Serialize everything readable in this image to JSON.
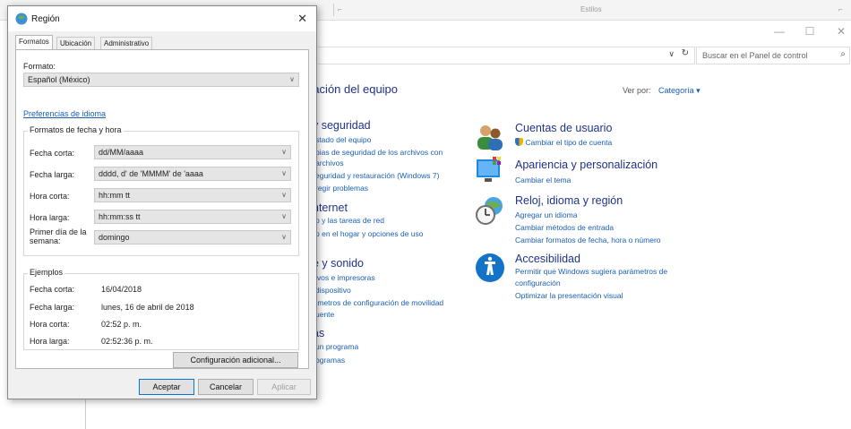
{
  "background": {
    "ribbon": {
      "left_group": "",
      "styles_group": "Estilos"
    },
    "search_placeholder": "Buscar en el Panel de control",
    "heading": "ración del equipo",
    "view_by_label": "Ver por:",
    "view_by_value": "Categoría",
    "left_categories": [
      {
        "title": "y seguridad",
        "links": [
          "stado del equipo",
          "pias de seguridad de los archivos con",
          "archivos",
          "eguridad y restauración (Windows 7)",
          "regir problemas"
        ]
      },
      {
        "title": "nternet",
        "links": [
          "o y las tareas de red",
          "p en el hogar y opciones de uso"
        ]
      },
      {
        "title": "e y sonido",
        "links": [
          "ivos e impresoras",
          "dispositivo",
          "ímetros de configuración de movilidad",
          "uente"
        ]
      },
      {
        "title": "as",
        "links": [
          "un programa",
          "ogramas"
        ]
      }
    ],
    "right_categories": [
      {
        "title": "Cuentas de usuario",
        "icon": "users-icon",
        "links": [
          "Cambiar el tipo de cuenta"
        ]
      },
      {
        "title": "Apariencia y personalización",
        "icon": "appearance-icon",
        "links": [
          "Cambiar el tema"
        ]
      },
      {
        "title": "Reloj, idioma y región",
        "icon": "clock-globe-icon",
        "links": [
          "Agregar un idioma",
          "Cambiar métodos de entrada",
          "Cambiar formatos de fecha, hora o número"
        ]
      },
      {
        "title": "Accesibilidad",
        "icon": "accessibility-icon",
        "links": [
          "Permitir que Windows sugiera parámetros de",
          "configuración",
          "Optimizar la presentación visual"
        ]
      }
    ]
  },
  "dialog": {
    "title": "Región",
    "tabs": [
      "Formatos",
      "Ubicación",
      "Administrativo"
    ],
    "format_label": "Formato:",
    "format_value": "Español (México)",
    "language_prefs_link": "Preferencias de idioma",
    "date_time_group": "Formatos de fecha y hora",
    "fields": [
      {
        "label": "Fecha corta:",
        "value": "dd/MM/aaaa"
      },
      {
        "label": "Fecha larga:",
        "value": "dddd, d' de 'MMMM' de 'aaaa"
      },
      {
        "label": "Hora corta:",
        "value": "hh:mm tt"
      },
      {
        "label": "Hora larga:",
        "value": "hh:mm:ss tt"
      },
      {
        "label": "Primer día de la semana:",
        "label_line1": "Primer día de la",
        "label_line2": "semana:",
        "value": "domingo"
      }
    ],
    "examples_group": "Ejemplos",
    "examples": [
      {
        "label": "Fecha corta:",
        "value": "16/04/2018"
      },
      {
        "label": "Fecha larga:",
        "value": "lunes, 16 de abril de 2018"
      },
      {
        "label": "Hora corta:",
        "value": "02:52 p. m."
      },
      {
        "label": "Hora larga:",
        "value": "02:52:36 p. m."
      }
    ],
    "additional_button": "Configuración adicional...",
    "ok_button": "Aceptar",
    "cancel_button": "Cancelar",
    "apply_button": "Aplicar"
  }
}
